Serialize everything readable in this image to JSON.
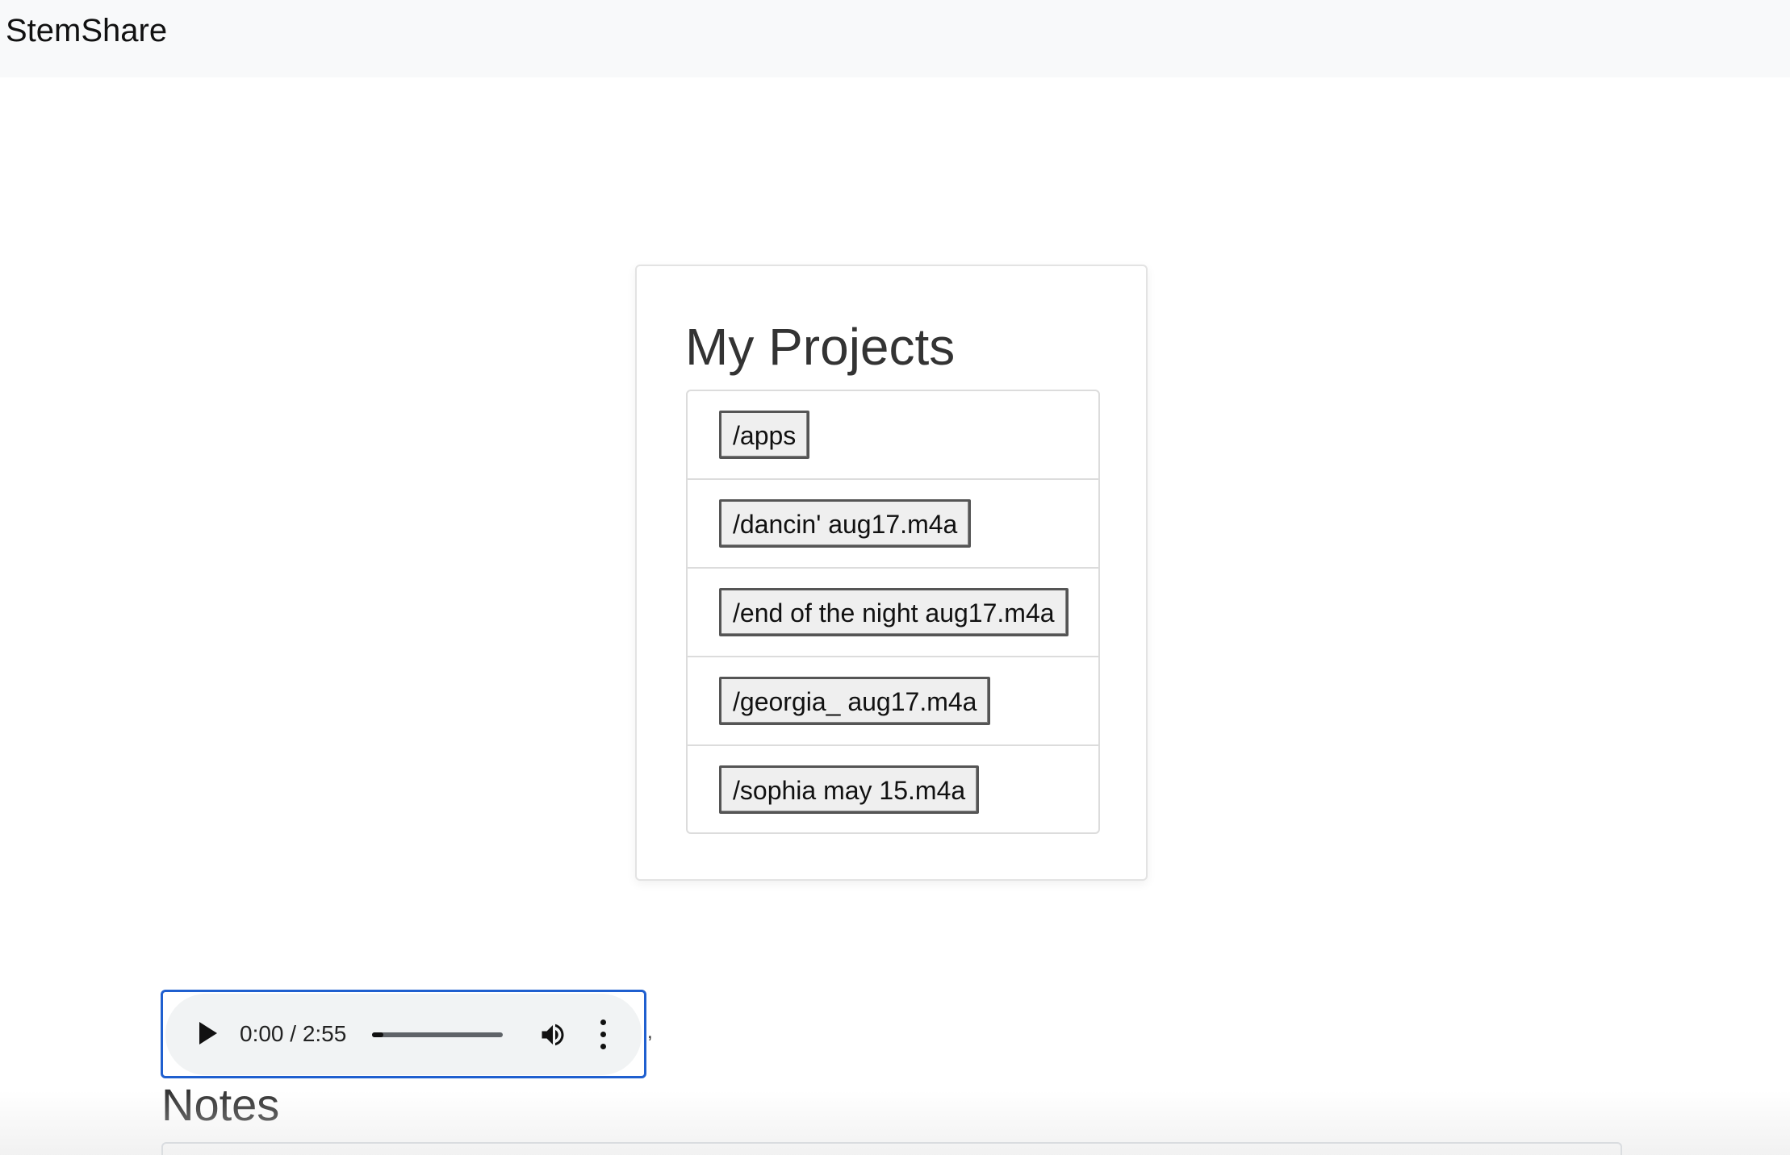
{
  "navbar": {
    "brand": "StemShare"
  },
  "projects": {
    "title": "My Projects",
    "items": [
      {
        "label": "/apps"
      },
      {
        "label": "/dancin' aug17.m4a"
      },
      {
        "label": "/end of the night aug17.m4a"
      },
      {
        "label": "/georgia_ aug17.m4a"
      },
      {
        "label": "/sophia may 15.m4a"
      }
    ]
  },
  "player": {
    "time": "0:00 / 2:55",
    "progress_fraction": 0.0,
    "icons": {
      "play": "play-icon",
      "volume": "volume-icon",
      "more": "more-vertical-icon"
    },
    "trailing_text": ","
  },
  "notes": {
    "title": "Notes"
  },
  "colors": {
    "navbar_bg": "#f8f9fa",
    "player_focus_border": "#1f5fcf",
    "player_bg": "#f1f3f4"
  }
}
